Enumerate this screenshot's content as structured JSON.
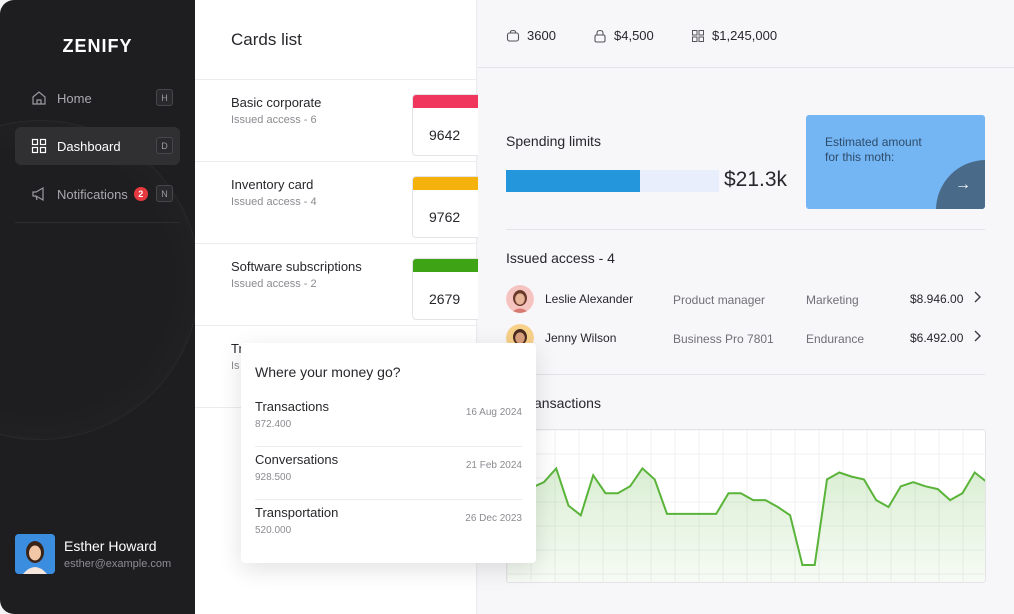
{
  "app": {
    "logo": "ZENIFY"
  },
  "sidebar": {
    "items": [
      {
        "label": "Home",
        "shortcut": "H",
        "icon": "home-icon"
      },
      {
        "label": "Dashboard",
        "shortcut": "D",
        "icon": "dashboard-icon",
        "active": true
      },
      {
        "label": "Notifications",
        "shortcut": "N",
        "icon": "megaphone-icon",
        "badge": "2"
      }
    ],
    "user": {
      "name": "Esther Howard",
      "email": "esther@example.com"
    }
  },
  "cards": {
    "title": "Cards list",
    "items": [
      {
        "name": "Basic corporate",
        "sub": "Issued access - 6",
        "number": "9642",
        "color": "#f0365c"
      },
      {
        "name": "Inventory card",
        "sub": "Issued access - 4",
        "number": "9762",
        "color": "#f5b10c"
      },
      {
        "name": "Software subscriptions",
        "sub": "Issued access - 2",
        "number": "2679",
        "color": "#3fa316"
      },
      {
        "name": "Tr",
        "sub": "Is"
      }
    ]
  },
  "popover": {
    "title": "Where your money go?",
    "items": [
      {
        "name": "Transactions",
        "value": "872.400",
        "date": "16 Aug 2024"
      },
      {
        "name": "Conversations",
        "value": "928.500",
        "date": "21 Feb 2024"
      },
      {
        "name": "Transportation",
        "value": "520.000",
        "date": "26 Dec 2023"
      }
    ]
  },
  "stats": [
    {
      "icon": "bag-icon",
      "value": "3600"
    },
    {
      "icon": "lock-icon",
      "value": "$4,500"
    },
    {
      "icon": "grid-icon",
      "value": "$1,245,000"
    }
  ],
  "spending": {
    "title": "Spending limits",
    "amount": "$21.3k",
    "progress": 0.63,
    "estimate_text": "Estimated amount for this moth:",
    "arrow": "→"
  },
  "access": {
    "title": "Issued access - 4",
    "people": [
      {
        "name": "Leslie Alexander",
        "role": "Product manager",
        "dept": "Marketing",
        "amount": "$8.946.00"
      },
      {
        "name": "Jenny Wilson",
        "role": "Business Pro 7801",
        "dept": "Endurance",
        "amount": "$6.492.00"
      }
    ]
  },
  "transactions": {
    "title": "nt Transactions"
  },
  "chart_data": {
    "type": "area",
    "title": "",
    "color": "#5ab43a",
    "x": [
      0,
      1,
      2,
      3,
      4,
      5,
      6,
      7,
      8,
      9,
      10,
      11,
      12,
      13,
      14,
      15,
      16,
      17,
      18,
      19,
      20,
      21,
      22,
      23,
      24,
      25,
      26,
      27,
      28,
      29,
      30,
      31,
      32,
      33,
      34,
      35,
      36,
      37,
      38,
      39
    ],
    "values": [
      50,
      38,
      64,
      68,
      78,
      51,
      44,
      73,
      60,
      60,
      65,
      78,
      70,
      45,
      45,
      45,
      45,
      45,
      60,
      60,
      55,
      55,
      50,
      44,
      8,
      8,
      70,
      75,
      72,
      70,
      55,
      50,
      65,
      68,
      65,
      63,
      55,
      60,
      75,
      68
    ],
    "ylim": [
      0,
      100
    ],
    "grid": true,
    "legend": "none"
  }
}
